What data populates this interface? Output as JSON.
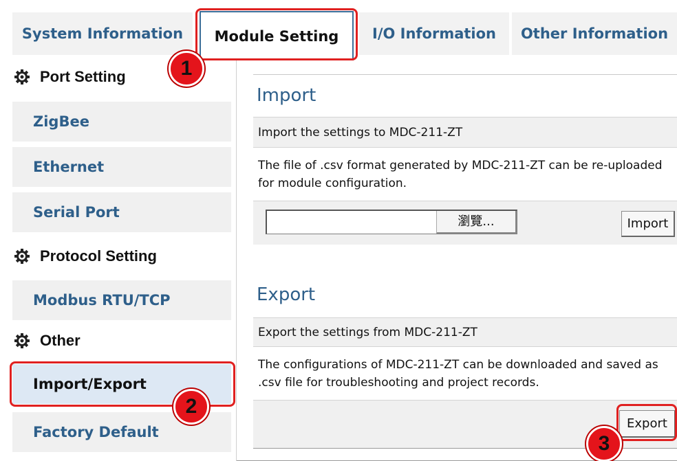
{
  "tabs": [
    {
      "label": "System Information"
    },
    {
      "label": "Module Setting"
    },
    {
      "label": "I/O Information"
    },
    {
      "label": "Other Information"
    }
  ],
  "sidebar": {
    "groups": [
      {
        "label": "Port Setting",
        "icon": "gear-icon"
      },
      {
        "label": "Protocol Setting",
        "icon": "gear-icon"
      },
      {
        "label": "Other",
        "icon": "gear-icon"
      }
    ],
    "items": [
      {
        "label": "ZigBee"
      },
      {
        "label": "Ethernet"
      },
      {
        "label": "Serial Port"
      },
      {
        "label": "Modbus RTU/TCP"
      },
      {
        "label": "Import/Export"
      },
      {
        "label": "Factory Default"
      }
    ]
  },
  "import": {
    "title": "Import",
    "subtitle": "Import the settings to MDC-211-ZT",
    "description": "The file of .csv format generated by MDC-211-ZT can be re-uploaded for module configuration.",
    "file_value": "",
    "browse_label": "瀏覽...",
    "button_label": "Import"
  },
  "export": {
    "title": "Export",
    "subtitle": "Export the settings from MDC-211-ZT",
    "description": "The configurations of MDC-211-ZT can be downloaded and saved as .csv file for troubleshooting and project records.",
    "button_label": "Export"
  },
  "annotations": {
    "badge_1": "1",
    "badge_2": "2",
    "badge_3": "3",
    "highlight_color": "#e02020"
  },
  "colors": {
    "link_blue": "#2e5f8a",
    "active_item_bg": "#dde8f4"
  }
}
